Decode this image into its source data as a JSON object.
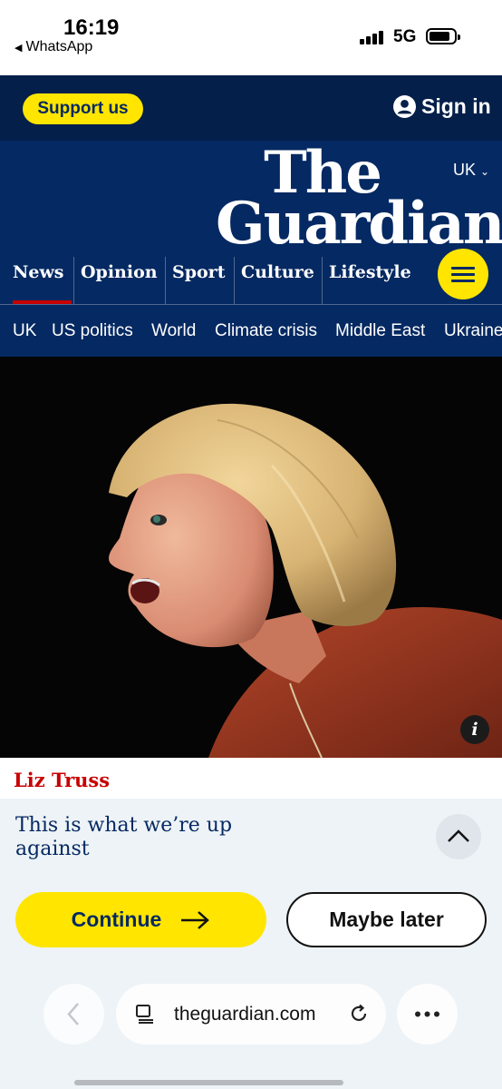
{
  "status_bar": {
    "time": "16:19",
    "back_app": "WhatsApp",
    "network": "5G"
  },
  "header": {
    "support_label": "Support us",
    "signin_label": "Sign in",
    "edition": "UK",
    "logo_line1": "The",
    "logo_line2": "Guardian",
    "brand_color": "#052962",
    "accent_color": "#ffe500"
  },
  "pillars": [
    {
      "label": "News",
      "active": true
    },
    {
      "label": "Opinion"
    },
    {
      "label": "Sport"
    },
    {
      "label": "Culture"
    },
    {
      "label": "Lifestyle"
    }
  ],
  "subnav": [
    "UK",
    "US politics",
    "World",
    "Climate crisis",
    "Middle East",
    "Ukraine"
  ],
  "article": {
    "image": "photo-of-liz-truss-speaking",
    "info_icon_label": "i",
    "kicker": "Liz Truss",
    "kicker_color": "#c70000",
    "headline": "This is what we’re up against"
  },
  "cta": {
    "continue_label": "Continue",
    "maybe_later_label": "Maybe later"
  },
  "browser": {
    "url": "theguardian.com",
    "icons": [
      "back-arrow-icon",
      "reader-icon",
      "reload-icon",
      "more-icon"
    ]
  }
}
